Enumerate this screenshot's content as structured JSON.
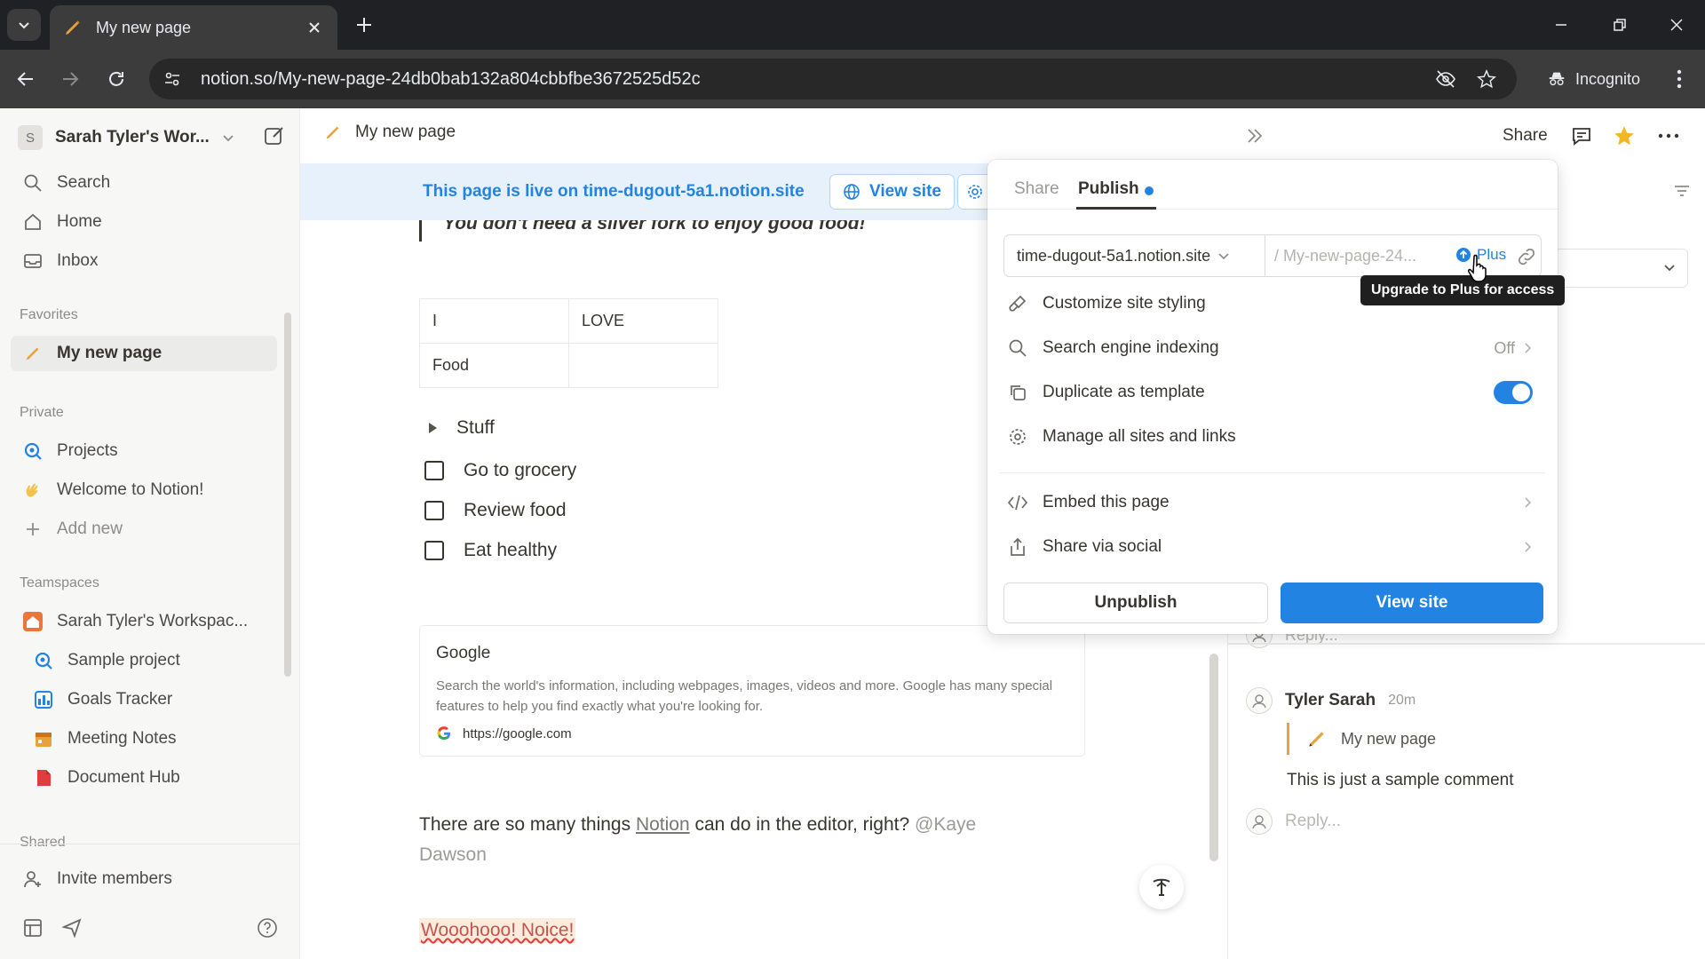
{
  "browser": {
    "tab_title": "My new page",
    "url": "notion.so/My-new-page-24db0bab132a804cbbfbe3672525d52c",
    "incognito_label": "Incognito"
  },
  "sidebar": {
    "workspace_initial": "S",
    "workspace_name": "Sarah Tyler's Wor...",
    "nav": {
      "search": "Search",
      "home": "Home",
      "inbox": "Inbox"
    },
    "favorites_heading": "Favorites",
    "favorites": [
      {
        "label": "My new page"
      }
    ],
    "private_heading": "Private",
    "private": [
      {
        "label": "Projects"
      },
      {
        "label": "Welcome to Notion!"
      },
      {
        "label": "Add new"
      }
    ],
    "teamspaces_heading": "Teamspaces",
    "teamspace_name": "Sarah Tyler's Workspac...",
    "teamspace_items": [
      {
        "label": "Sample project"
      },
      {
        "label": "Goals Tracker"
      },
      {
        "label": "Meeting Notes"
      },
      {
        "label": "Document Hub"
      }
    ],
    "shared_heading": "Shared",
    "invite_label": "Invite members"
  },
  "header": {
    "breadcrumb": "My new page",
    "share_label": "Share"
  },
  "banner": {
    "text": "This page is live on time-dugout-5a1.notion.site",
    "view_site_label": "View site"
  },
  "editor": {
    "quote": "You don't need a silver fork to enjoy good food!",
    "table": [
      [
        "I",
        "LOVE"
      ],
      [
        "Food",
        ""
      ]
    ],
    "toggle_label": "Stuff",
    "todos": [
      {
        "label": "Go to grocery",
        "checked": false
      },
      {
        "label": "Review food",
        "checked": false
      },
      {
        "label": "Eat healthy",
        "checked": false
      }
    ],
    "bookmark": {
      "title": "Google",
      "description": "Search the world's information, including webpages, images, videos and more. Google has many special features to help you find exactly what you're looking for.",
      "url": "https://google.com"
    },
    "paragraph": {
      "before": "There are so many things ",
      "link": "Notion",
      "after": " can do in the editor, right? ",
      "mention": "@Kaye Dawson"
    },
    "highlight": "Wooohooo! Noice!"
  },
  "publish_popover": {
    "tabs": [
      "Share",
      "Publish"
    ],
    "active_tab": "Publish",
    "domain": "time-dugout-5a1.notion.site",
    "slug": "/ My-new-page-24...",
    "plus_badge": "Plus",
    "rows": {
      "customize": "Customize site styling",
      "indexing": "Search engine indexing",
      "indexing_value": "Off",
      "duplicate": "Duplicate as template",
      "duplicate_enabled": true,
      "manage": "Manage all sites and links",
      "embed": "Embed this page",
      "social": "Share via social"
    },
    "unpublish_label": "Unpublish",
    "view_site_label": "View site"
  },
  "tooltip": "Upgrade to Plus for access",
  "comments": {
    "reply_placeholder_top": "Reply...",
    "author": "Tyler Sarah",
    "time": "20m",
    "quoted_page": "My new page",
    "text": "This is just a sample comment",
    "reply_placeholder": "Reply..."
  },
  "colors": {
    "accent": "#2383e2",
    "banner_bg": "#e7f1fb",
    "sidebar_bg": "#f7f7f5",
    "chrome_dark": "#202124",
    "chrome_toolbar": "#3c3c3c"
  }
}
